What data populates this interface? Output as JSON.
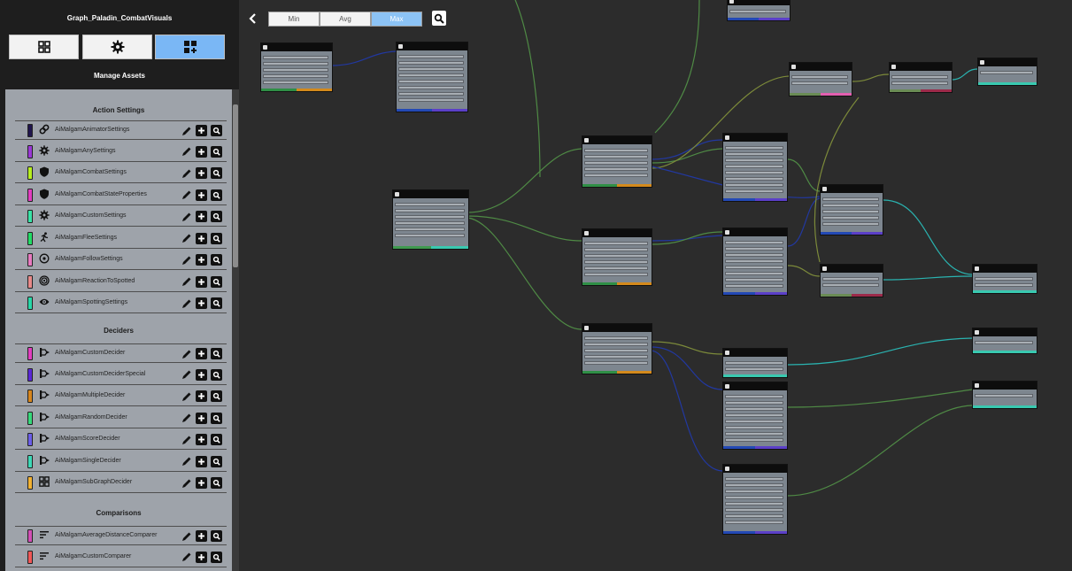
{
  "sidebar": {
    "title": "Graph_Paladin_CombatVisuals",
    "tabs": [
      {
        "name": "grid-icon",
        "selected": false
      },
      {
        "name": "gear-icon",
        "selected": false
      },
      {
        "name": "add-grid-icon",
        "selected": true
      }
    ],
    "manage_title": "Manage Assets",
    "sections": [
      {
        "title": "Action Settings",
        "items": [
          {
            "label": "AiMalgamAnimatorSettings",
            "color": "#20154d",
            "icon": "link-icon"
          },
          {
            "label": "AiMalgamAnySettings",
            "color": "#9a38d6",
            "icon": "gear-icon"
          },
          {
            "label": "AiMalgamCombatSettings",
            "color": "#b7ef1f",
            "icon": "shield-icon"
          },
          {
            "label": "AiMalgamCombatStateProperties",
            "color": "#e23ec0",
            "icon": "shield-icon"
          },
          {
            "label": "AiMalgamCustomSettings",
            "color": "#39e3a7",
            "icon": "gear-icon"
          },
          {
            "label": "AiMalgamFleeSettings",
            "color": "#23dc66",
            "icon": "run-icon"
          },
          {
            "label": "AiMalgamFollowSettings",
            "color": "#e87ac0",
            "icon": "target-icon"
          },
          {
            "label": "AiMalgamReactionToSpotted",
            "color": "#e88a8a",
            "icon": "at-icon"
          },
          {
            "label": "AiMalgamSpottingSettings",
            "color": "#28d8a8",
            "icon": "eye-icon"
          }
        ]
      },
      {
        "title": "Deciders",
        "items": [
          {
            "label": "AiMalgamCustomDecider",
            "color": "#e23ec0",
            "icon": "decider-icon"
          },
          {
            "label": "AiMalgamCustomDeciderSpecial",
            "color": "#5a28d6",
            "icon": "decider-icon"
          },
          {
            "label": "AiMalgamMultipleDecider",
            "color": "#d7861d",
            "icon": "decider-icon"
          },
          {
            "label": "AiMalgamRandomDecider",
            "color": "#37d97b",
            "icon": "decider-icon"
          },
          {
            "label": "AiMalgamScoreDecider",
            "color": "#6b5ee8",
            "icon": "decider-icon"
          },
          {
            "label": "AiMalgamSingleDecider",
            "color": "#3dd9b7",
            "icon": "decider-icon"
          },
          {
            "label": "AiMalgamSubGraphDecider",
            "color": "#f2b233",
            "icon": "grid-icon"
          }
        ]
      },
      {
        "title": "Comparisons",
        "items": [
          {
            "label": "AiMalgamAverageDistanceComparer",
            "color": "#d24fb5",
            "icon": "compare-icon"
          },
          {
            "label": "AiMalgamCustomComparer",
            "color": "#f05757",
            "icon": "compare-icon"
          }
        ]
      }
    ]
  },
  "toolbar": {
    "back": "chevron-left-icon",
    "detail_options": [
      "Min",
      "Avg",
      "Max"
    ],
    "selected": "Max",
    "frame": "frame-search-icon"
  },
  "canvas": {
    "colors": {
      "background": "#2c2c2c",
      "node_body": "#7d868f",
      "wire_green": "#4f8a45",
      "wire_blue": "#2238a0",
      "wire_teal": "#2ab3b0",
      "wire_olive": "#7c8a3a"
    }
  }
}
